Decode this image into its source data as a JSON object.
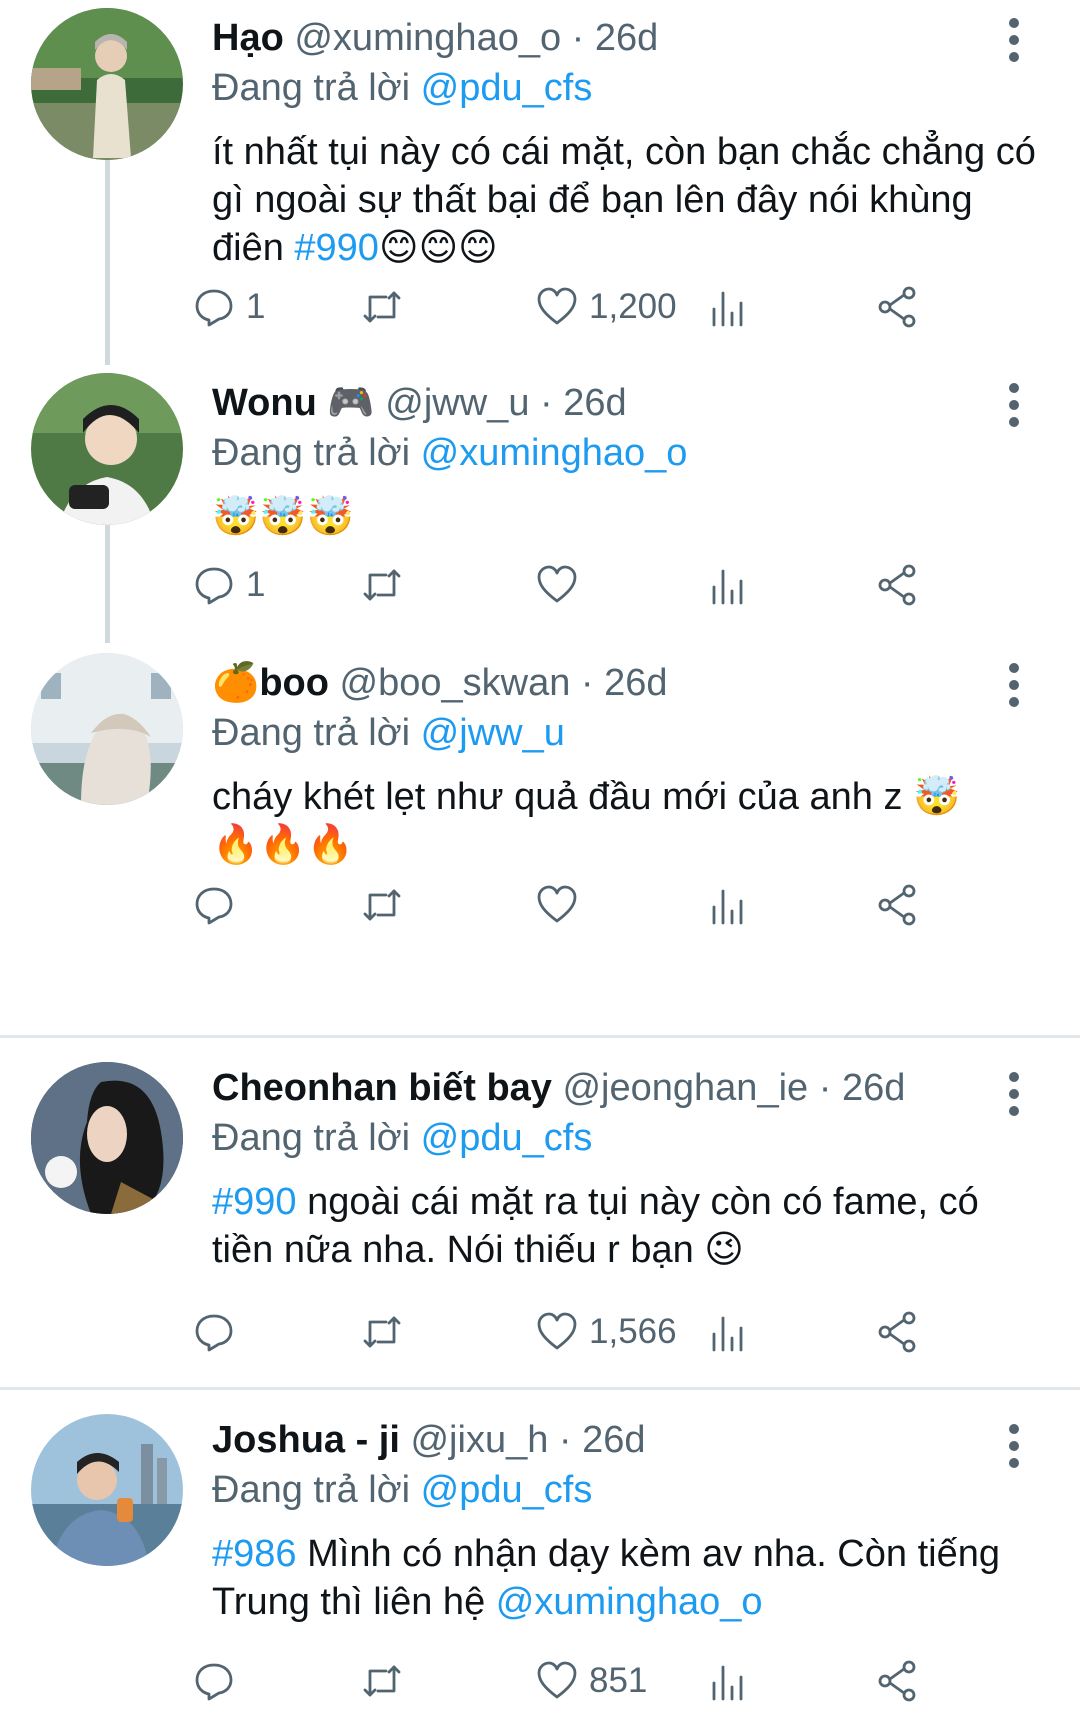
{
  "tweets": [
    {
      "name": "Hạo",
      "handle": "@xuminghao_o",
      "dot": "·",
      "time": "26d",
      "replying_label": "Đang trả lời",
      "replying_to": "@pdu_cfs",
      "text_before": "ít nhất tụi này có cái mặt, còn bạn chắc chẳng có gì ngoài sự thất bại để bạn lên đây nói khùng điên ",
      "hashtag": "#990",
      "text_after": "😊😊😊",
      "reply_count": "1",
      "retweet_count": "",
      "like_count": "1,200"
    },
    {
      "name": "Wonu",
      "name_emoji": "🎮",
      "handle": "@jww_u",
      "dot": "·",
      "time": "26d",
      "replying_label": "Đang trả lời",
      "replying_to": "@xuminghao_o",
      "text": "🤯🤯🤯",
      "reply_count": "1",
      "retweet_count": "",
      "like_count": ""
    },
    {
      "name_emoji": "🍊",
      "name": "boo",
      "handle": "@boo_skwan",
      "dot": "·",
      "time": "26d",
      "replying_label": "Đang trả lời",
      "replying_to": "@jww_u",
      "text": "cháy khét lẹt như quả đầu mới của anh z 🤯",
      "text_line2": "🔥🔥🔥",
      "reply_count": "",
      "retweet_count": "",
      "like_count": ""
    },
    {
      "name": "Cheonhan biết bay",
      "handle": "@jeonghan_ie",
      "dot": "·",
      "time": "26d",
      "replying_label": "Đang trả lời",
      "replying_to": "@pdu_cfs",
      "hashtag": "#990",
      "text_after": " ngoài cái mặt ra tụi này còn có fame, có tiền nữa nha. Nói thiếu r bạn 😉",
      "reply_count": "",
      "retweet_count": "",
      "like_count": "1,566"
    },
    {
      "name": "Joshua - ji",
      "handle": "@jixu_h",
      "dot": "·",
      "time": "26d",
      "replying_label": "Đang trả lời",
      "replying_to": "@pdu_cfs",
      "hashtag": "#986",
      "text_after": " Mình có nhận dạy kèm av nha. Còn tiếng Trung thì liên hệ ",
      "mention_in_text": "@xuminghao_o",
      "reply_count": "",
      "retweet_count": "",
      "like_count": "851"
    }
  ],
  "icons": {
    "reply": "reply-icon",
    "retweet": "retweet-icon",
    "like": "heart-icon",
    "views": "views-chart-icon",
    "share": "share-icon",
    "more": "more-vertical-icon"
  },
  "colors": {
    "link": "#1d9bf0",
    "secondary_text": "#536471",
    "separator": "#e1e8ed"
  }
}
